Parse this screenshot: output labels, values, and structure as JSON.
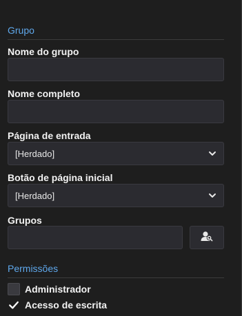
{
  "group_section": {
    "title": "Grupo"
  },
  "fields": {
    "group_name": {
      "label": "Nome do grupo",
      "value": ""
    },
    "full_name": {
      "label": "Nome completo",
      "value": ""
    },
    "landing_page": {
      "label": "Página de entrada",
      "selected": "[Herdado]"
    },
    "home_button": {
      "label": "Botão de página inicial",
      "selected": "[Herdado]"
    },
    "groups": {
      "label": "Grupos",
      "value": "",
      "button_icon": "user-lookup-icon"
    }
  },
  "permissions_section": {
    "title": "Permissões",
    "items": [
      {
        "label": "Administrador",
        "checked": false
      },
      {
        "label": "Acesso de escrita",
        "checked": true
      }
    ]
  },
  "colors": {
    "background": "#1e1e1e",
    "accent": "#5fa8ec",
    "input_bg": "#2b2b30",
    "label": "#f2f2f2"
  }
}
